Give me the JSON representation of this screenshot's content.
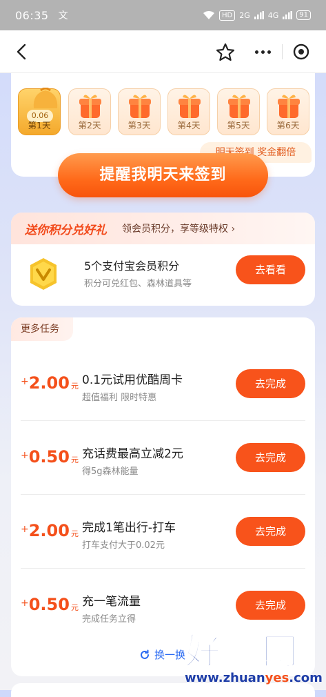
{
  "status_bar": {
    "time": "06:35",
    "notification": "文",
    "hd_label": "HD",
    "net1": "2G",
    "net2": "4G",
    "battery": "91"
  },
  "nav": {
    "back_icon": "back-chevron-icon",
    "favorite_icon": "star-outline-icon",
    "more_icon": "more-dots-icon",
    "close_icon": "target-close-icon"
  },
  "signin": {
    "days": [
      {
        "label": "第1天",
        "amount": "0.06",
        "active": true
      },
      {
        "label": "第2天"
      },
      {
        "label": "第3天"
      },
      {
        "label": "第4天"
      },
      {
        "label": "第5天"
      },
      {
        "label": "第6天"
      }
    ],
    "bonus_tip": "明天签到 奖金翻倍",
    "remind_button": "提醒我明天来签到"
  },
  "gift": {
    "title": "送你积分兑好礼",
    "subtitle": "领会员积分，享等级特权 ›",
    "item_name": "5个支付宝会员积分",
    "item_desc": "积分可兑红包、森林道具等",
    "button": "去看看"
  },
  "tasks": {
    "tag": "更多任务",
    "items": [
      {
        "plus": "+",
        "amount": "2.00",
        "unit": "元",
        "name": "0.1元试用优酷周卡",
        "desc": "超值福利 限时特惠",
        "button": "去完成"
      },
      {
        "plus": "+",
        "amount": "0.50",
        "unit": "元",
        "name": "充话费最高立减2元",
        "desc": "得5g森林能量",
        "button": "去完成"
      },
      {
        "plus": "+",
        "amount": "2.00",
        "unit": "元",
        "name": "完成1笔出行-打车",
        "desc": "打车支付大于0.02元",
        "button": "去完成"
      },
      {
        "plus": "+",
        "amount": "0.50",
        "unit": "元",
        "name": "充一笔流量",
        "desc": "完成任务立得",
        "button": "去完成"
      }
    ],
    "refresh": "换一换"
  },
  "watermark": {
    "big": "好赚网",
    "url_prefix": "www.zhuan",
    "url_highlight": "yes",
    "url_suffix": ".com"
  },
  "colors": {
    "accent": "#f8531b",
    "link": "#2b6bf2"
  }
}
